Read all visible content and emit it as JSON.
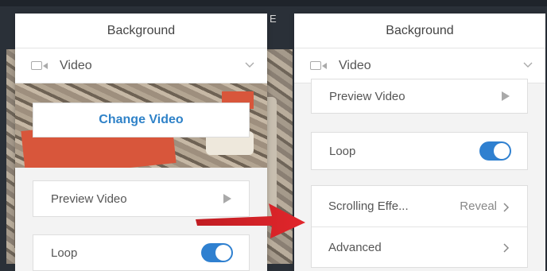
{
  "left_panel": {
    "title": "Background",
    "type_label": "Video",
    "change_button": "Change Video",
    "preview_label": "Preview Video",
    "loop_label": "Loop",
    "loop_on": true
  },
  "right_panel": {
    "title": "Background",
    "type_label": "Video",
    "preview_label": "Preview Video",
    "loop_label": "Loop",
    "loop_on": true,
    "scrolling_label": "Scrolling Effe...",
    "scrolling_value": "Reveal",
    "advanced_label": "Advanced"
  },
  "editor": {
    "partial_text": "E"
  },
  "colors": {
    "accent": "#2f80d0",
    "arrow": "#d9262a",
    "link": "#2f82c8"
  },
  "icons": [
    "video-icon",
    "chevron-down-icon",
    "play-icon",
    "chevron-right-icon",
    "arrow-right-icon"
  ]
}
